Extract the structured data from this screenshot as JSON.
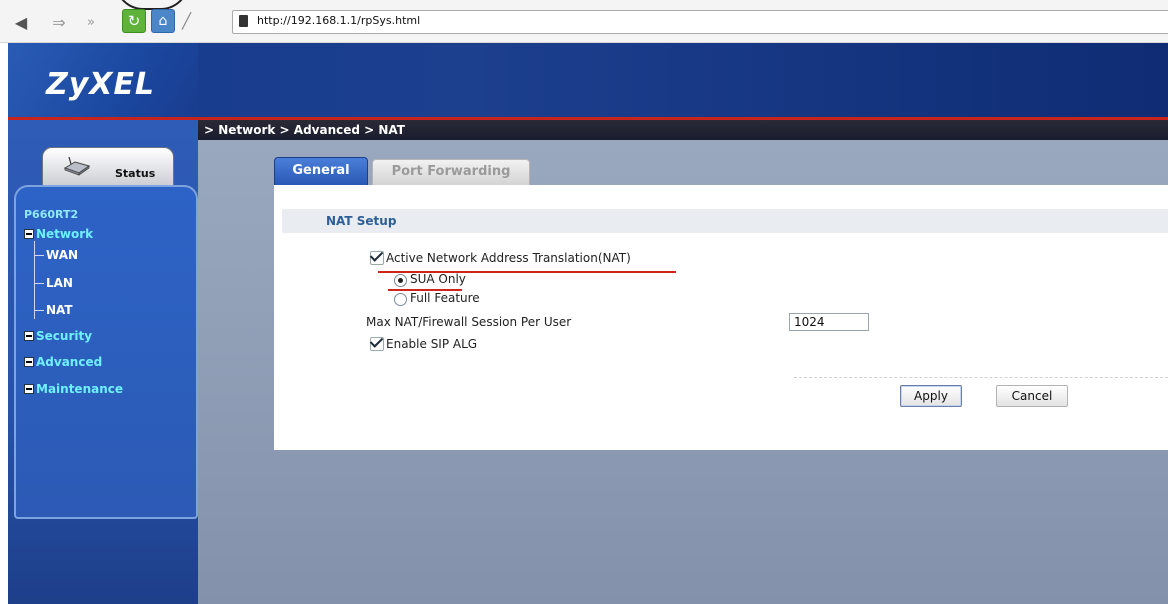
{
  "browser": {
    "url": "http://192.168.1.1/rpSys.html",
    "icons": [
      "back-arrow-icon",
      "forward-arrow-icon",
      "fast-forward-icon",
      "refresh-icon",
      "home-icon",
      "pen-icon",
      "page-icon"
    ]
  },
  "header": {
    "logo": "ZyXEL",
    "breadcrumb": "> Network > Advanced > NAT"
  },
  "sidebar": {
    "status_label": "Status",
    "model": "P660RT2",
    "menu": {
      "network": "Network",
      "sub_items": [
        "WAN",
        "LAN",
        "NAT"
      ],
      "security": "Security",
      "advanced": "Advanced",
      "maintenance": "Maintenance"
    }
  },
  "tabs": {
    "general": "General",
    "port_forwarding": "Port Forwarding",
    "active": "General"
  },
  "nat_setup": {
    "section_title": "NAT Setup",
    "active_nat_label": "Active Network Address Translation(NAT)",
    "active_nat_checked": true,
    "sua_only_label": "SUA Only",
    "full_feature_label": "Full Feature",
    "selected_mode": "SUA Only",
    "max_session_label": "Max NAT/Firewall Session Per User",
    "max_session_value": "1024",
    "sip_alg_label": "Enable SIP ALG",
    "sip_alg_checked": true
  },
  "buttons": {
    "apply": "Apply",
    "cancel": "Cancel"
  },
  "colors": {
    "header_blue": "#173b8f",
    "accent_red": "#c8241d",
    "menu_cyan": "#6ff0ff",
    "section_title": "#2d5f96"
  }
}
